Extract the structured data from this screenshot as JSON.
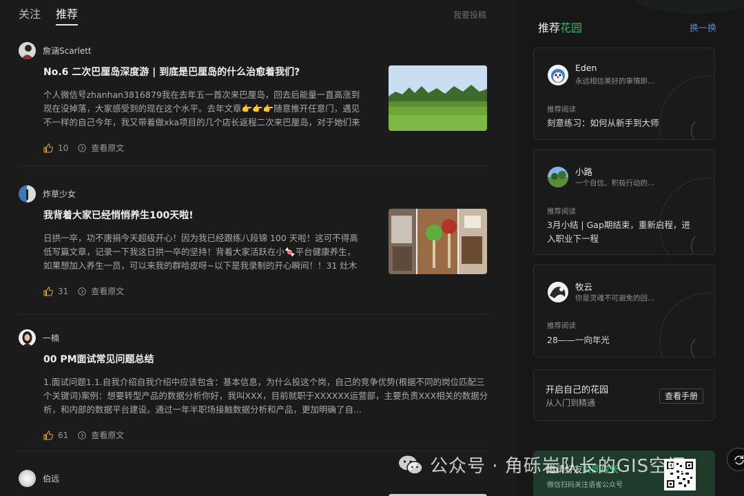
{
  "tabs": [
    {
      "label": "关注",
      "active": false
    },
    {
      "label": "推荐",
      "active": true
    }
  ],
  "submit_label": "我要投稿",
  "posts": [
    {
      "author": "詹涵Scarlett",
      "title": "No.6 二次巴厘岛深度游 | 到底是巴厘岛的什么治愈着我们?",
      "excerpt": "个人微信号zhanhan3816879我在去年五一首次来巴厘岛，回去后能量一直高涨到现在没掉落，大家感受到的现在这个水平。去年文章👉👉👉随意推开任意门，遇见不一样的自己今年，我又带着做xka项目的几个店长返程二次来巴厘岛，对于她们来说感...",
      "likes": "10",
      "view_label": "查看原文"
    },
    {
      "author": "炸草少女",
      "title": "我背着大家已经悄悄养生100天啦!",
      "excerpt": "日拱一卒，功不唐捐今天超级开心！因为我已经跟练八段锦 100 天啦！这可不得高低写篇文章，记录一下我这日拱一卒的坚持！背着大家活跃在小🍬平台健康养生，如果想加入养生一员，可以来我的群哈皮呀~以下是我录制的开心瞬间！！31 灶木养生...",
      "likes": "31",
      "view_label": "查看原文"
    },
    {
      "author": "一楠",
      "title": "00 PM面试常见问题总结",
      "excerpt": "1.面试问题1.1.自我介绍自我介绍中应该包含：基本信息，为什么投这个岗，自己的竞争优势(根据不同的岗位匹配三个关键词)案例：想要转型产品的数据分析你好，我叫XXX，目前就职于XXXXXX运营部，主要负责XXX相关的数据分析，和内部的数据平台建设。通过一年半职场接触数据分析和产品，更加明确了自...",
      "likes": "61",
      "view_label": "查看原文"
    },
    {
      "author": "伯远"
    }
  ],
  "sidebar": {
    "title_prefix": "推荐",
    "title_highlight": "花园",
    "refresh_label": "换一换",
    "gardens": [
      {
        "name": "Eden",
        "bio": "永远相信美好的事情即...",
        "label": "推荐阅读",
        "read": "刻意练习：如何从新手到大师"
      },
      {
        "name": "小路",
        "bio": "一个自信、积极行动的...",
        "label": "推荐阅读",
        "read": "3月小结 | Gap期结束，重新启程，进入职业下一程"
      },
      {
        "name": "牧云",
        "bio": "你是灵魂不可避免的回...",
        "label": "推荐阅读",
        "read": "28——一向年光"
      }
    ],
    "open": {
      "title": "开启自己的花园",
      "subtitle": "从入门到精通",
      "button": "查看手册"
    },
    "promo": {
      "title_prefix": "邀请好友",
      "title_highlight": "共同成长",
      "subtitle": "微信扫码关注语雀公众号"
    }
  },
  "watermark": "公众号 · 角砾岩队长的GIS空间",
  "colors": {
    "accent_green": "#3bb371",
    "link_blue": "#4c8edc"
  }
}
